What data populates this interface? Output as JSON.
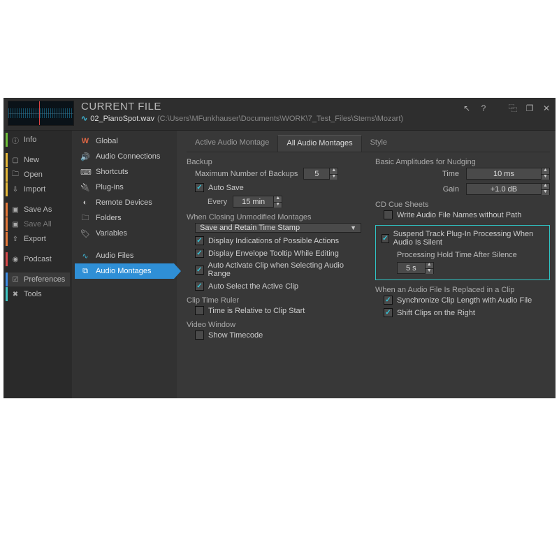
{
  "header": {
    "title": "CURRENT FILE",
    "filename": "02_PianoSpot.wav",
    "path": "(C:\\Users\\MFunkhauser\\Documents\\WORK\\7_Test_Files\\Stems\\Mozart)"
  },
  "rail": {
    "info": "Info",
    "new": "New",
    "open": "Open",
    "import": "Import",
    "saveas": "Save As",
    "saveall": "Save All",
    "export": "Export",
    "podcast": "Podcast",
    "preferences": "Preferences",
    "tools": "Tools"
  },
  "mid": {
    "global": "Global",
    "audio_connections": "Audio Connections",
    "shortcuts": "Shortcuts",
    "plugins": "Plug-ins",
    "remote": "Remote Devices",
    "folders": "Folders",
    "variables": "Variables",
    "audio_files": "Audio Files",
    "audio_montages": "Audio Montages"
  },
  "tabs": {
    "active": "Active Audio Montage",
    "all": "All Audio Montages",
    "style": "Style"
  },
  "left_col": {
    "backup_title": "Backup",
    "max_backups_label": "Maximum Number of Backups",
    "max_backups_value": "5",
    "auto_save": "Auto Save",
    "every_label": "Every",
    "every_value": "15 min",
    "closing_title": "When Closing Unmodified Montages",
    "closing_value": "Save and Retain Time Stamp",
    "display_indications": "Display Indications of Possible Actions",
    "display_tooltip": "Display Envelope Tooltip While Editing",
    "auto_activate": "Auto Activate Clip when Selecting Audio Range",
    "auto_select": "Auto Select the Active Clip",
    "clip_ruler_title": "Clip Time Ruler",
    "clip_ruler_check": "Time is Relative to Clip Start",
    "video_title": "Video Window",
    "video_check": "Show Timecode"
  },
  "right_col": {
    "nudge_title": "Basic Amplitudes for Nudging",
    "time_label": "Time",
    "time_value": "10 ms",
    "gain_label": "Gain",
    "gain_value": "+1.0 dB",
    "cue_title": "CD Cue Sheets",
    "cue_check": "Write Audio File Names without Path",
    "suspend_check": "Suspend Track Plug-In Processing When Audio Is Silent",
    "hold_label": "Processing Hold Time After Silence",
    "hold_value": "5 s",
    "replaced_title": "When an Audio File Is Replaced in a Clip",
    "sync_check": "Synchronize Clip Length with Audio File",
    "shift_check": "Shift Clips on the Right"
  }
}
